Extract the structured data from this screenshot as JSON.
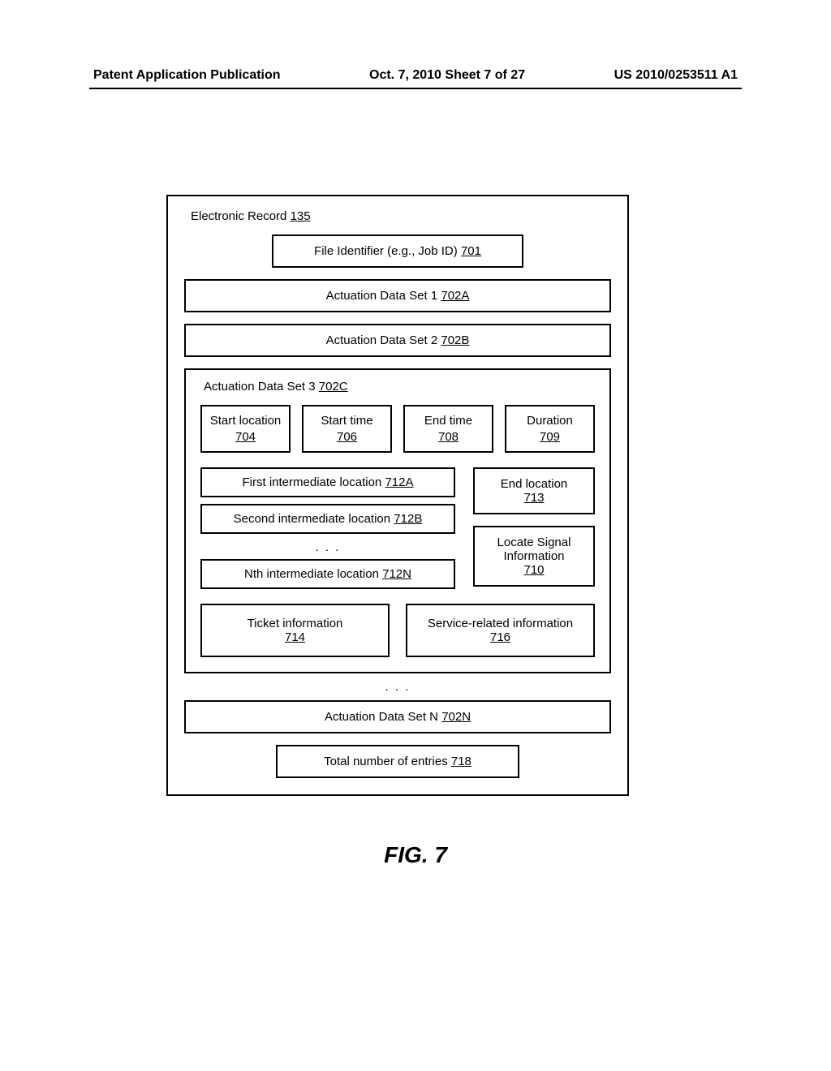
{
  "header": {
    "left": "Patent Application Publication",
    "middle": "Oct. 7, 2010  Sheet 7 of 27",
    "right": "US 2010/0253511 A1"
  },
  "record": {
    "title_text": "Electronic Record",
    "title_ref": "135",
    "file_identifier_text": "File Identifier (e.g., Job ID)",
    "file_identifier_ref": "701",
    "set1_text": "Actuation Data Set 1",
    "set1_ref": "702A",
    "set2_text": "Actuation Data Set 2",
    "set2_ref": "702B",
    "set3": {
      "title_text": "Actuation Data Set 3",
      "title_ref": "702C",
      "start_location_text": "Start location",
      "start_location_ref": "704",
      "start_time_text": "Start time",
      "start_time_ref": "706",
      "end_time_text": "End time",
      "end_time_ref": "708",
      "duration_text": "Duration",
      "duration_ref": "709",
      "first_intermediate_text": "First intermediate location",
      "first_intermediate_ref": "712A",
      "second_intermediate_text": "Second intermediate location",
      "second_intermediate_ref": "712B",
      "intermediate_dots": ". . .",
      "nth_intermediate_text": "Nth intermediate location",
      "nth_intermediate_ref": "712N",
      "end_location_text": "End location",
      "end_location_ref": "713",
      "locate_signal_text": "Locate Signal Information",
      "locate_signal_ref": "710",
      "ticket_text": "Ticket information",
      "ticket_ref": "714",
      "service_text": "Service-related information",
      "service_ref": "716"
    },
    "between_dots": ". . .",
    "setN_text": "Actuation Data Set N",
    "setN_ref": "702N",
    "total_text": "Total number of entries",
    "total_ref": "718"
  },
  "figure_label": "FIG. 7"
}
